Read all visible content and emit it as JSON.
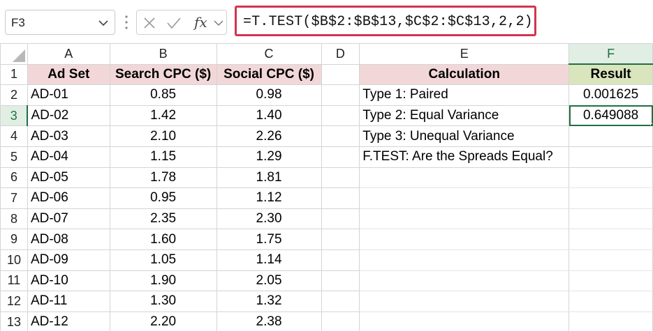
{
  "name_box": {
    "value": "F3"
  },
  "formula_bar": {
    "fx_label": "fx",
    "formula": "=T.TEST($B$2:$B$13,$C$2:$C$13,2,2)"
  },
  "columns": [
    "A",
    "B",
    "C",
    "D",
    "E",
    "F"
  ],
  "rows": [
    "1",
    "2",
    "3",
    "4",
    "5",
    "6",
    "7",
    "8",
    "9",
    "10",
    "11",
    "12",
    "13"
  ],
  "headers": {
    "ad_set": "Ad Set",
    "search_cpc": "Search CPC ($)",
    "social_cpc": "Social CPC ($)",
    "calculation": "Calculation",
    "result": "Result"
  },
  "ad_data": [
    {
      "ad_set": "AD-01",
      "search": "0.85",
      "social": "0.98"
    },
    {
      "ad_set": "AD-02",
      "search": "1.42",
      "social": "1.40"
    },
    {
      "ad_set": "AD-03",
      "search": "2.10",
      "social": "2.26"
    },
    {
      "ad_set": "AD-04",
      "search": "1.15",
      "social": "1.29"
    },
    {
      "ad_set": "AD-05",
      "search": "1.78",
      "social": "1.81"
    },
    {
      "ad_set": "AD-06",
      "search": "0.95",
      "social": "1.12"
    },
    {
      "ad_set": "AD-07",
      "search": "2.35",
      "social": "2.30"
    },
    {
      "ad_set": "AD-08",
      "search": "1.60",
      "social": "1.75"
    },
    {
      "ad_set": "AD-09",
      "search": "1.05",
      "social": "1.14"
    },
    {
      "ad_set": "AD-10",
      "search": "1.90",
      "social": "2.05"
    },
    {
      "ad_set": "AD-11",
      "search": "1.30",
      "social": "1.32"
    },
    {
      "ad_set": "AD-12",
      "search": "2.20",
      "social": "2.38"
    }
  ],
  "calculations": [
    {
      "label": "Type 1: Paired",
      "result": "0.001625"
    },
    {
      "label": "Type 2: Equal Variance",
      "result": "0.649088"
    },
    {
      "label": "Type 3: Unequal Variance",
      "result": ""
    },
    {
      "label": "F.TEST: Are the Spreads Equal?",
      "result": ""
    }
  ],
  "active_cell": "F3",
  "colors": {
    "accent_green": "#1f6f41",
    "formula_border": "#d2344f",
    "header_pink": "#f2d7d9",
    "header_green": "#d8e5bd"
  }
}
